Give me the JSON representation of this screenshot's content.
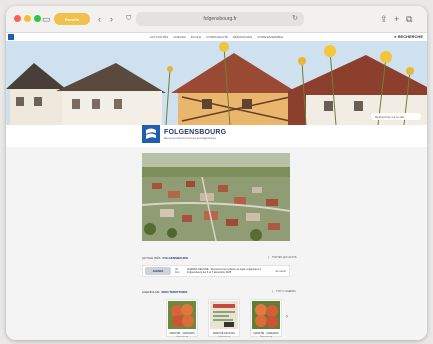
{
  "browser": {
    "group_label": "Favoris",
    "address": "folgensbourg.fr",
    "icons": {
      "sidebar": "sidebar-icon",
      "back": "chevron-left-icon",
      "forward": "chevron-right-icon",
      "shield": "shield-icon",
      "reload": "reload-icon",
      "share": "share-icon",
      "new_tab": "plus-icon",
      "tabs": "tabs-icon"
    }
  },
  "site": {
    "nav": [
      "ACTUALITÉS",
      "AGENDA",
      "ÉCOLE",
      "COMMUNAUTÉ",
      "DÉMARCHES",
      "VIVRE ENSEMBLE"
    ],
    "search_label": "RECHERCHE",
    "hero_search_placeholder": "Rechercher sur le site",
    "logo_title": "FOLGENSBOURG",
    "logo_sub": "Bienvenue dans la commune de Folgensbourg",
    "news_section": {
      "prefix": "ACTUALITÉS",
      "name": "FOLGENSBOURG",
      "more": "TOUTES LES ACTUS"
    },
    "news_item": {
      "thumb": "AGENDA",
      "date_day": "06",
      "date_month": "Déc.",
      "text": "AGENDA SÉCURE · Découvrez les collecte de sapin organisées à Folgensbourg les 6 et 7 décembre 2025",
      "more": "En savoir"
    },
    "region_section": {
      "prefix": "AGENDA DE",
      "name": "MON TERRITOIRE",
      "more": "TOUT L'AGENDA"
    },
    "cards": [
      {
        "title": "MARCHÉ - VERGERS",
        "date": "Folgensbourg"
      },
      {
        "title": "MARCHÉ DE NOËL",
        "date": "Folgensbourg"
      },
      {
        "title": "MARCHÉ - VERGERS",
        "date": "Folgensbourg"
      }
    ],
    "colors": {
      "brand": "#1f5fae",
      "title": "#1f3b6e",
      "accent": "#f0c14b"
    }
  }
}
